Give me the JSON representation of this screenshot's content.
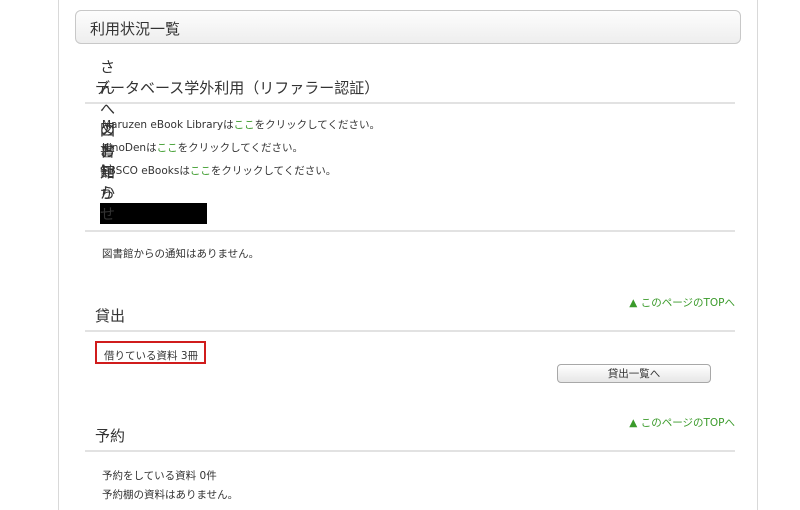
{
  "header": {
    "title": "利用状況一覧"
  },
  "database": {
    "heading": "データベース学外利用（リファラー認証）",
    "lines": [
      {
        "before": "Maruzen eBook Libraryは",
        "link": "ここ",
        "after": "をクリックしてください。"
      },
      {
        "before": "KinoDenは",
        "link": "ここ",
        "after": "をクリックしてください。"
      },
      {
        "before": "EBSCO eBooksは",
        "link": "ここ",
        "after": "をクリックしてください。"
      }
    ]
  },
  "notice": {
    "heading_part1": "図書館 から",
    "heading_part2": "さんへのお知らせ",
    "message": "図書館からの通知はありません。"
  },
  "loans": {
    "top_link": "▲ このページのTOPへ",
    "heading": "貸出",
    "count_text": "借りている資料 3冊",
    "list_button": "貸出一覧へ"
  },
  "reservations": {
    "top_link": "▲ このページのTOPへ",
    "heading": "予約",
    "count_text": "予約をしている資料 0件",
    "shelf_text": "予約棚の資料はありません。"
  }
}
